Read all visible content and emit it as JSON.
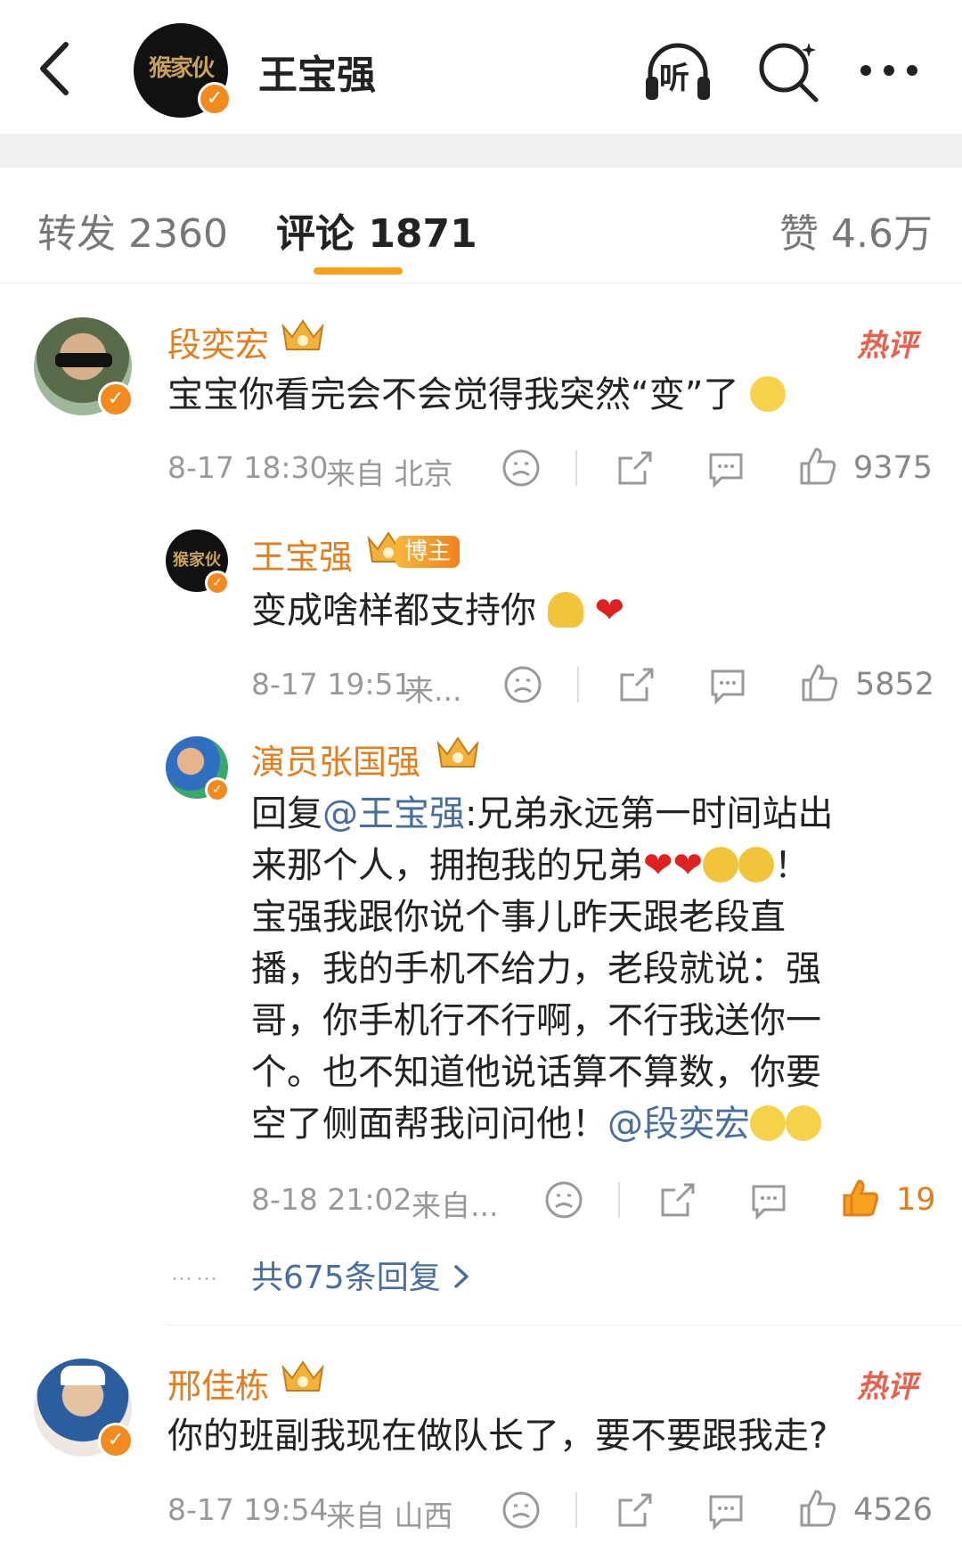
{
  "header": {
    "name": "王宝强",
    "avatar_text": "猴家伙",
    "back_icon": "chevron-left-icon",
    "listen_label": "听",
    "search_icon": "search-icon",
    "more_icon": "more-icon"
  },
  "tabs": [
    {
      "label": "转发 2360"
    },
    {
      "label": "评论 1871"
    },
    {
      "label": "赞 4.6万"
    }
  ],
  "hot_label": "热评",
  "host_badge": "博主",
  "comments": [
    {
      "name": "段奕宏",
      "text": "宝宝你看完会不会觉得我突然“变”了",
      "time": "8-17 18:30",
      "location": "来自 北京",
      "likes": "9375"
    },
    {
      "name": "王宝强",
      "text": "变成啥样都支持你",
      "time": "8-17 19:51",
      "location": "来...",
      "likes": "5852"
    },
    {
      "name": "演员张国强",
      "reply_prefix": "回复",
      "reply_at": "@王宝强",
      "text_lines": [
        ":兄弟永远第一时间站出",
        "来那个人，拥抱我的兄弟",
        "宝强我跟你说个事儿昨天跟老段直",
        "播，我的手机不给力，老段就说：强",
        "哥，你手机行不行啊，不行我送你一",
        "个。也不知道他说话算不算数，你要",
        "空了侧面帮我问问他！"
      ],
      "mention": "@段奕宏",
      "exclaim": "！",
      "time": "8-18 21:02",
      "location": "来自...",
      "likes": "19"
    },
    {
      "name": "邢佳栋",
      "text": "你的班副我现在做队长了，要不要跟我走?",
      "time": "8-17 19:54",
      "location": "来自 山西",
      "likes": "4526"
    }
  ],
  "replies_link": "共675条回复",
  "replies_dots": "……",
  "colors": {
    "accent": "#e47d1b",
    "link": "#486e9f",
    "hot": "#e8604a"
  }
}
